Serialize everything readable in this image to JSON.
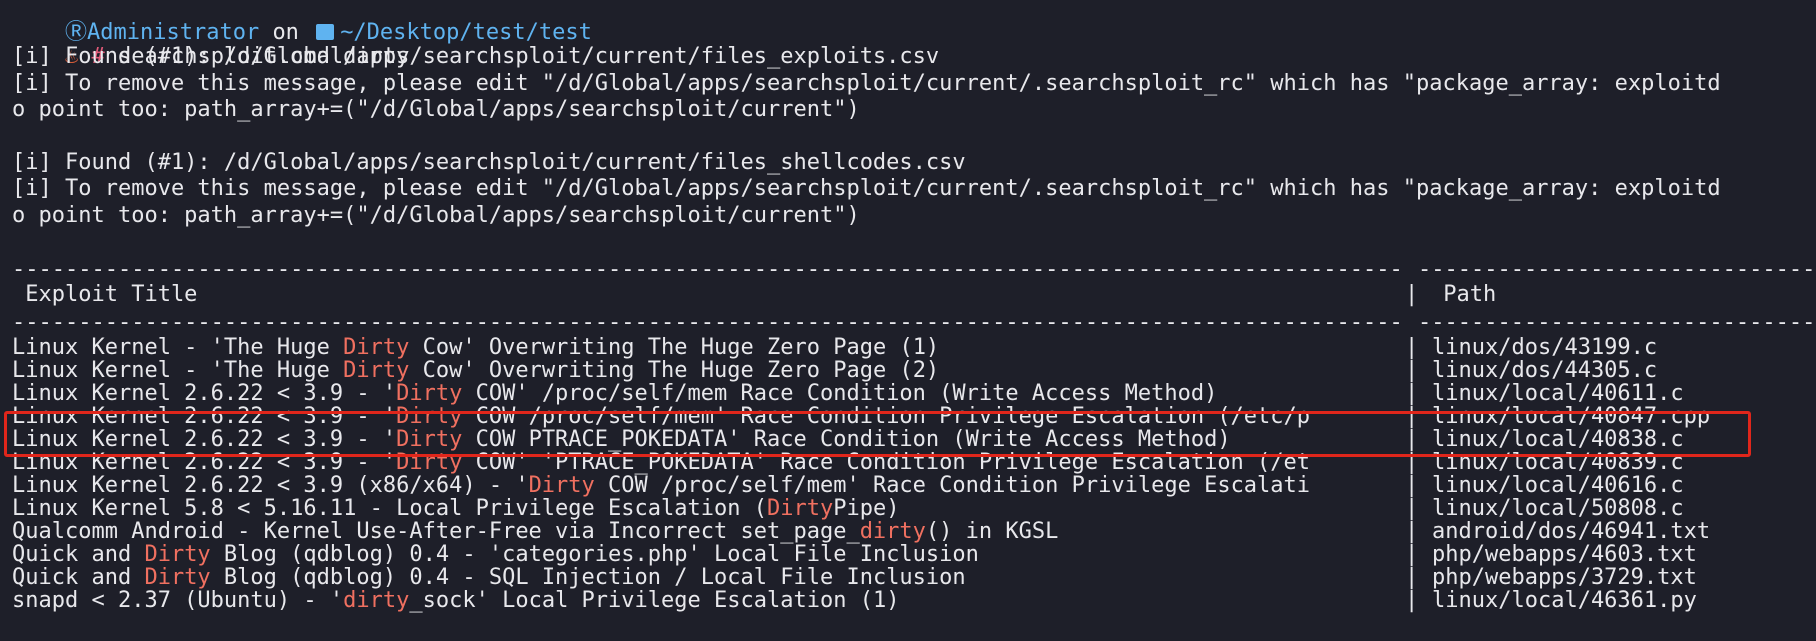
{
  "prompt": {
    "user": "Administrator",
    "on_word": "on",
    "dir": "~/Desktop/test/test",
    "hash": "#",
    "command": "searchsploit.cmd dirty"
  },
  "messages": [
    "[i] Found (#1): /d/Global/apps/searchsploit/current/files_exploits.csv",
    "[i] To remove this message, please edit \"/d/Global/apps/searchsploit/current/.searchsploit_rc\" which has \"package_array: exploitd",
    "o point too: path_array+=(\"/d/Global/apps/searchsploit/current\")",
    "",
    "[i] Found (#1): /d/Global/apps/searchsploit/current/files_shellcodes.csv",
    "[i] To remove this message, please edit \"/d/Global/apps/searchsploit/current/.searchsploit_rc\" which has \"package_array: exploitd",
    "o point too: path_array+=(\"/d/Global/apps/searchsploit/current\")"
  ],
  "separator": "-----------------------------------------------------------------------------------------------------------------------------------------",
  "table": {
    "col_title": " Exploit Title",
    "col_divider": "|",
    "col_path": " Path",
    "rows": [
      {
        "pre": "Linux Kernel - 'The Huge ",
        "hl": "Dirty",
        "post": " Cow' Overwriting The Huge Zero Page (1)",
        "path": "linux/dos/43199.c"
      },
      {
        "pre": "Linux Kernel - 'The Huge ",
        "hl": "Dirty",
        "post": " Cow' Overwriting The Huge Zero Page (2)",
        "path": "linux/dos/44305.c"
      },
      {
        "pre": "Linux Kernel 2.6.22 < 3.9 - '",
        "hl": "Dirty",
        "post": " COW' /proc/self/mem Race Condition (Write Access Method)",
        "path": "linux/local/40611.c"
      },
      {
        "pre": "Linux Kernel 2.6.22 < 3.9 - '",
        "hl": "Dirty",
        "post": " COW /proc/self/mem' Race Condition Privilege Escalation (/etc/p",
        "path": "linux/local/40847.cpp"
      },
      {
        "pre": "Linux Kernel 2.6.22 < 3.9 - '",
        "hl": "Dirty",
        "post": " COW PTRACE_POKEDATA' Race Condition (Write Access Method)",
        "path": "linux/local/40838.c"
      },
      {
        "pre": "Linux Kernel 2.6.22 < 3.9 - '",
        "hl": "Dirty",
        "post": " COW' 'PTRACE_POKEDATA' Race Condition Privilege Escalation (/et",
        "path": "linux/local/40839.c"
      },
      {
        "pre": "Linux Kernel 2.6.22 < 3.9 (x86/x64) - '",
        "hl": "Dirty",
        "post": " COW /proc/self/mem' Race Condition Privilege Escalati",
        "path": "linux/local/40616.c"
      },
      {
        "pre": "Linux Kernel 5.8 < 5.16.11 - Local Privilege Escalation (",
        "hl": "Dirty",
        "post": "Pipe)",
        "path": "linux/local/50808.c"
      },
      {
        "pre": "Qualcomm Android - Kernel Use-After-Free via Incorrect set_page_",
        "hl": "dirty",
        "post": "() in KGSL",
        "path": "android/dos/46941.txt"
      },
      {
        "pre": "Quick and ",
        "hl": "Dirty",
        "post": " Blog (qdblog) 0.4 - 'categories.php' Local File Inclusion",
        "path": "php/webapps/4603.txt"
      },
      {
        "pre": "Quick and ",
        "hl": "Dirty",
        "post": " Blog (qdblog) 0.4 - SQL Injection / Local File Inclusion",
        "path": "php/webapps/3729.txt"
      },
      {
        "pre": "snapd < 2.37 (Ubuntu) - '",
        "hl": "dirty",
        "post": "_sock' Local Privilege Escalation (1)",
        "path": "linux/local/46361.py"
      }
    ]
  },
  "colors": {
    "background": "#1e1f29",
    "text": "#e8e8ec",
    "highlight": "#f07060",
    "prompt": "#5fb3f0",
    "box": "#e0261b"
  }
}
